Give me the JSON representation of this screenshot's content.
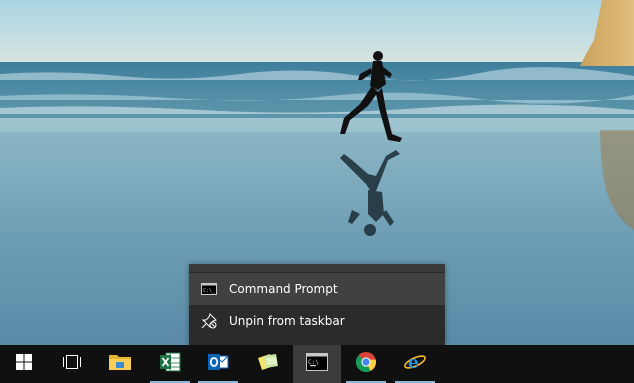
{
  "desktop": {
    "wallpaper": "beach-runner-wallpaper"
  },
  "jumplist": {
    "items": [
      {
        "label": "Command Prompt",
        "icon": "command-prompt-icon"
      },
      {
        "label": "Unpin from taskbar",
        "icon": "unpin-icon"
      }
    ]
  },
  "taskbar": {
    "apps": [
      {
        "name": "start",
        "icon": "windows-logo-icon"
      },
      {
        "name": "task-view",
        "icon": "task-view-icon"
      },
      {
        "name": "file-explorer",
        "icon": "folder-icon"
      },
      {
        "name": "excel",
        "icon": "excel-icon"
      },
      {
        "name": "outlook",
        "icon": "outlook-icon"
      },
      {
        "name": "sticky-notes",
        "icon": "sticky-notes-icon"
      },
      {
        "name": "command-prompt",
        "icon": "command-prompt-icon",
        "active": true
      },
      {
        "name": "chrome",
        "icon": "chrome-icon"
      },
      {
        "name": "internet-explorer",
        "icon": "internet-explorer-icon"
      }
    ],
    "colors": {
      "background": "#101010",
      "active": "#3c3c3c",
      "underline": "#8ab6d8"
    }
  }
}
